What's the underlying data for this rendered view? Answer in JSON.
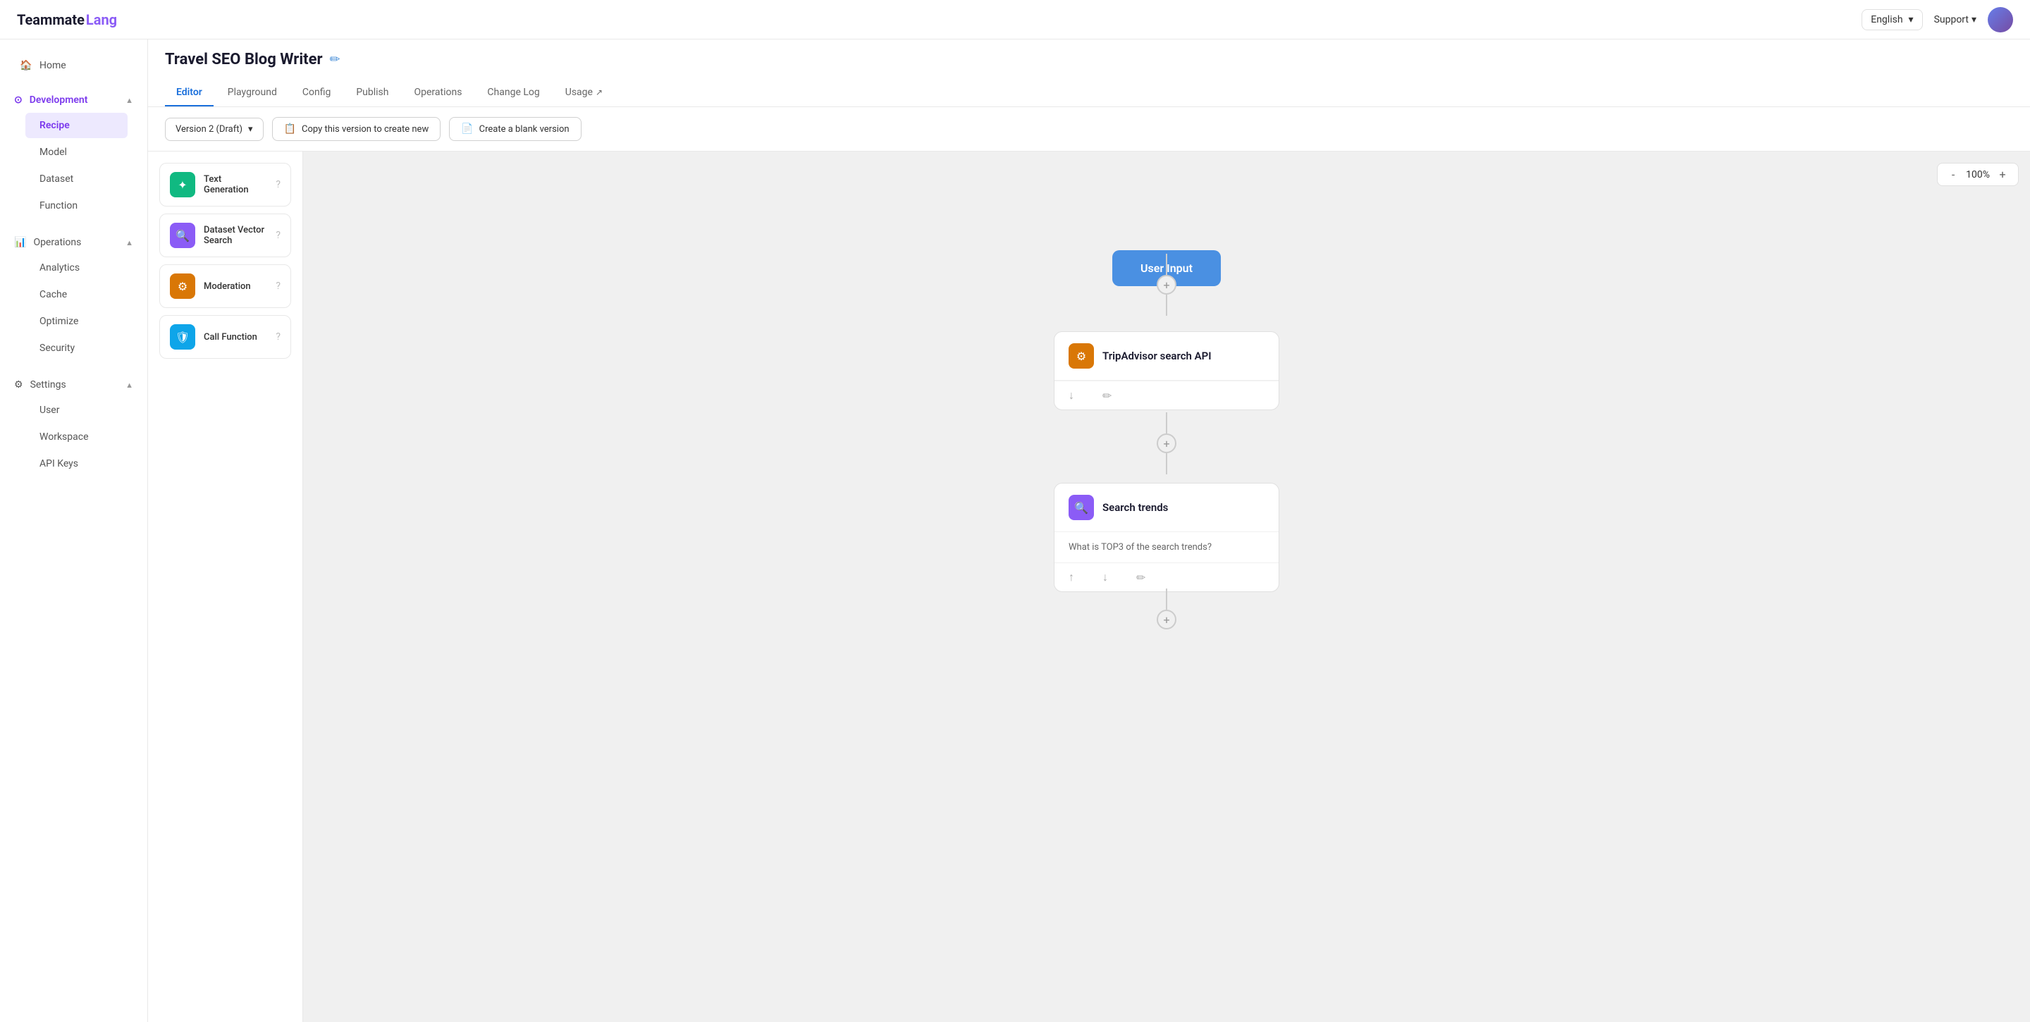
{
  "topbar": {
    "logo_teammate": "Teammate",
    "logo_lang": "Lang",
    "language": "English",
    "support_label": "Support",
    "chevron_down": "▾"
  },
  "sidebar": {
    "home_label": "Home",
    "development_label": "Development",
    "recipe_label": "Recipe",
    "model_label": "Model",
    "dataset_label": "Dataset",
    "function_label": "Function",
    "operations_label": "Operations",
    "analytics_label": "Analytics",
    "cache_label": "Cache",
    "optimize_label": "Optimize",
    "security_label": "Security",
    "settings_label": "Settings",
    "user_label": "User",
    "workspace_label": "Workspace",
    "api_keys_label": "API Keys"
  },
  "page": {
    "title": "Travel SEO Blog Writer",
    "edit_icon": "✏"
  },
  "tabs": [
    {
      "id": "editor",
      "label": "Editor",
      "active": true,
      "external": false
    },
    {
      "id": "playground",
      "label": "Playground",
      "active": false,
      "external": false
    },
    {
      "id": "config",
      "label": "Config",
      "active": false,
      "external": false
    },
    {
      "id": "publish",
      "label": "Publish",
      "active": false,
      "external": false
    },
    {
      "id": "operations",
      "label": "Operations",
      "active": false,
      "external": false
    },
    {
      "id": "changelog",
      "label": "Change Log",
      "active": false,
      "external": false
    },
    {
      "id": "usage",
      "label": "Usage",
      "active": false,
      "external": true
    }
  ],
  "toolbar": {
    "version_label": "Version 2 (Draft)",
    "copy_btn": "Copy this version to create new",
    "blank_btn": "Create a blank version",
    "copy_icon": "📋",
    "blank_icon": "📄"
  },
  "components": [
    {
      "id": "text-gen",
      "label": "Text Generation",
      "icon": "✦",
      "color": "green"
    },
    {
      "id": "dataset-vector",
      "label": "Dataset Vector Search",
      "icon": "🔍",
      "color": "purple"
    },
    {
      "id": "moderation",
      "label": "Moderation",
      "icon": "⚙",
      "color": "amber"
    },
    {
      "id": "call-function",
      "label": "Call Function",
      "icon": "🛡",
      "color": "teal"
    }
  ],
  "canvas": {
    "zoom_label": "100%",
    "zoom_minus": "-",
    "zoom_plus": "+",
    "user_input_label": "User Input",
    "nodes": [
      {
        "id": "tripadvisor",
        "title": "TripAdvisor search API",
        "icon": "⚙",
        "icon_color": "amber",
        "has_body": false,
        "actions": [
          "↓",
          "✏"
        ]
      },
      {
        "id": "search-trends",
        "title": "Search trends",
        "icon": "🔍",
        "icon_color": "purple",
        "has_body": true,
        "body_text": "What is TOP3 of the search trends?",
        "actions": [
          "↑",
          "↓",
          "✏"
        ]
      }
    ]
  }
}
